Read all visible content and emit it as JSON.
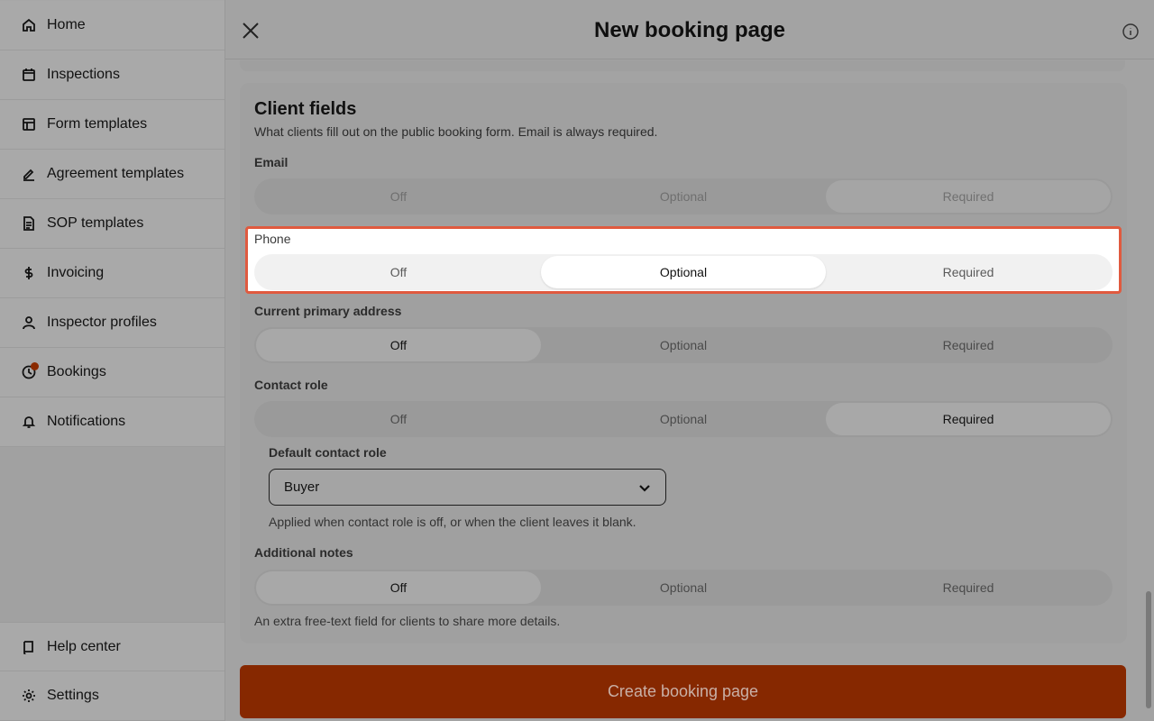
{
  "sidebar": {
    "items": [
      {
        "label": "Home",
        "icon": "home-icon"
      },
      {
        "label": "Inspections",
        "icon": "calendar-icon"
      },
      {
        "label": "Form templates",
        "icon": "layout-icon"
      },
      {
        "label": "Agreement templates",
        "icon": "signature-icon"
      },
      {
        "label": "SOP templates",
        "icon": "document-icon"
      },
      {
        "label": "Invoicing",
        "icon": "dollar-icon"
      },
      {
        "label": "Inspector profiles",
        "icon": "user-icon"
      },
      {
        "label": "Bookings",
        "icon": "clock-icon"
      },
      {
        "label": "Notifications",
        "icon": "bell-icon"
      }
    ],
    "bottom_items": [
      {
        "label": "Help center",
        "icon": "book-icon"
      },
      {
        "label": "Settings",
        "icon": "gear-icon"
      }
    ]
  },
  "header": {
    "title": "New booking page",
    "close_icon": "close-icon",
    "info_icon": "info-icon"
  },
  "section": {
    "title": "Client fields",
    "description": "What clients fill out on the public booking form. Email is always required."
  },
  "fields": {
    "email": {
      "label": "Email",
      "options": [
        "Off",
        "Optional",
        "Required"
      ],
      "selected": "Required"
    },
    "phone": {
      "label": "Phone",
      "options": [
        "Off",
        "Optional",
        "Required"
      ],
      "selected": "Optional"
    },
    "address": {
      "label": "Current primary address",
      "options": [
        "Off",
        "Optional",
        "Required"
      ],
      "selected": "Off"
    },
    "contact_role": {
      "label": "Contact role",
      "options": [
        "Off",
        "Optional",
        "Required"
      ],
      "selected": "Required"
    },
    "notes": {
      "label": "Additional notes",
      "options": [
        "Off",
        "Optional",
        "Required"
      ],
      "selected": "Off"
    }
  },
  "default_contact_role": {
    "label": "Default contact role",
    "value": "Buyer",
    "help": "Applied when contact role is off, or when the client leaves it blank."
  },
  "notes_help": "An extra free-text field for clients to share more details.",
  "cta_label": "Create booking page",
  "colors": {
    "accent": "#862800",
    "highlight_border": "#e05a3f",
    "notification_dot": "#8a2a00"
  }
}
